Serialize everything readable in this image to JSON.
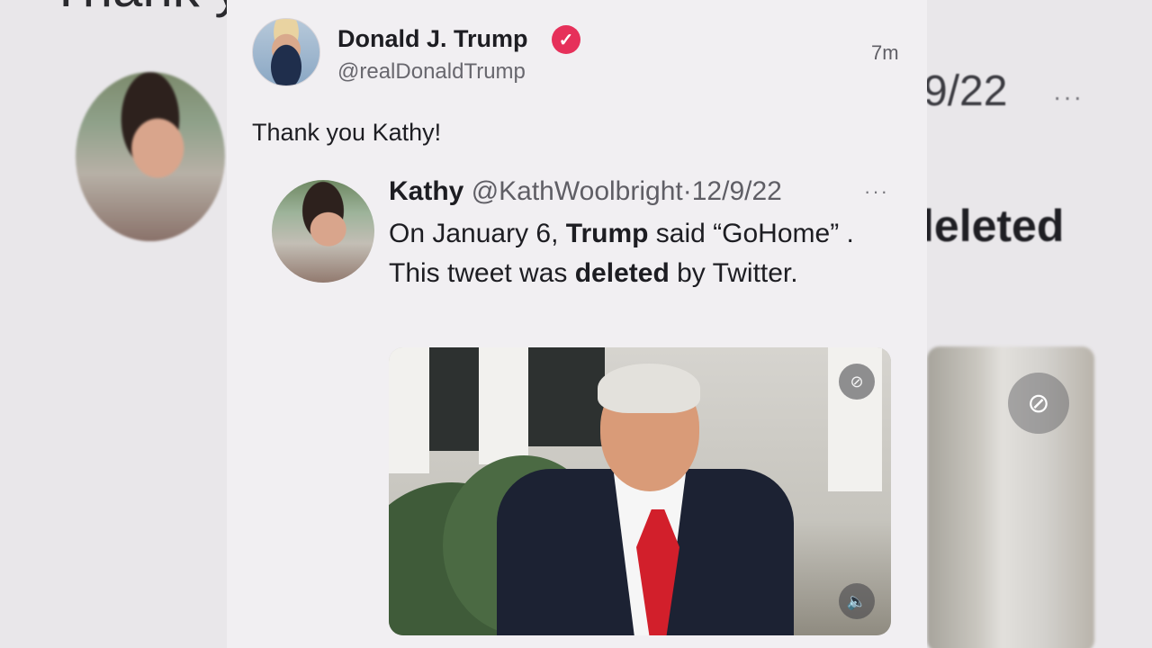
{
  "background": {
    "heading": "Thank yo",
    "date_fragment": "9/22",
    "deleted_fragment": "leleted"
  },
  "tweet": {
    "author": {
      "display_name": "Donald J. Trump",
      "handle": "@realDonaldTrump",
      "verified": true
    },
    "timestamp": "7m",
    "text": "Thank you Kathy!",
    "quote": {
      "author_name": "Kathy",
      "author_handle": "@KathWoolbright",
      "separator": "·",
      "date": "12/9/22",
      "text_part1": "On January 6, ",
      "text_bold1": "Trump",
      "text_part2": " said “GoHome” . This tweet was ",
      "text_bold2": "deleted",
      "text_part3": " by Twitter.",
      "more_label": "···"
    }
  },
  "colors": {
    "verified_badge": "#e6305a",
    "background": "#e9e7ea",
    "card": "#f1eff2"
  },
  "icons": {
    "verified": "checkmark-badge-icon",
    "gif_off": "gif-off-icon",
    "volume": "volume-icon"
  }
}
